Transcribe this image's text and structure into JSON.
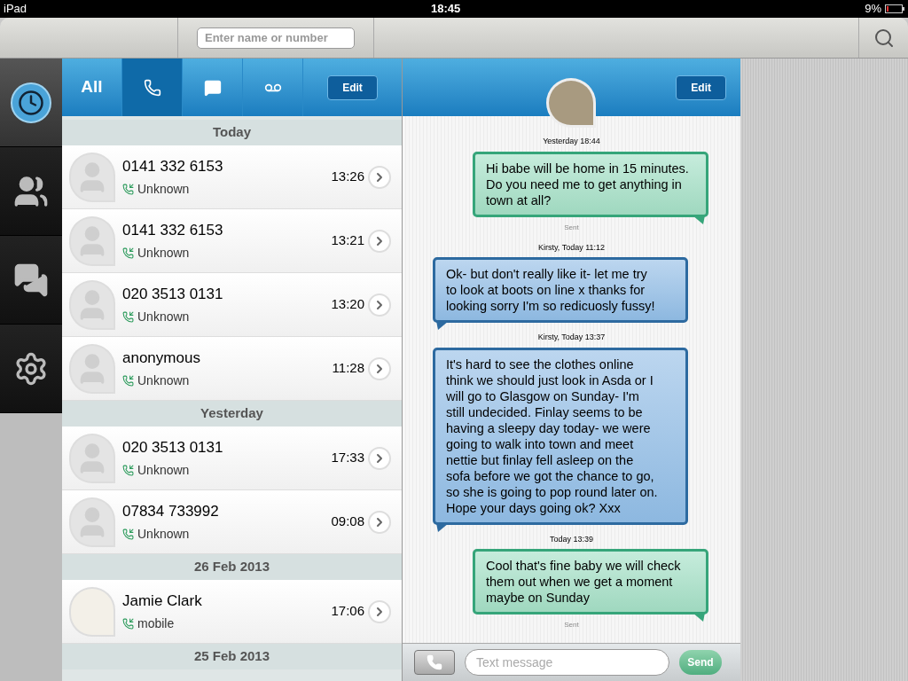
{
  "status_bar": {
    "device": "iPad",
    "time": "18:45",
    "battery": "9%"
  },
  "search": {
    "placeholder": "Enter name or number"
  },
  "rail": [
    {
      "kind": "recents",
      "selected": true
    },
    {
      "kind": "contacts",
      "selected": false
    },
    {
      "kind": "messages",
      "selected": false
    },
    {
      "kind": "settings",
      "selected": false
    }
  ],
  "call_tabs": [
    {
      "kind": "all",
      "label": "All",
      "selected": false
    },
    {
      "kind": "calls",
      "selected": true
    },
    {
      "kind": "messages",
      "selected": false
    },
    {
      "kind": "voicemail",
      "selected": false
    }
  ],
  "calls_edit": "Edit",
  "sections": [
    {
      "title": "Today",
      "rows": [
        {
          "kind": "silhouette",
          "name": "0141 332 6153",
          "type": "Unknown",
          "time": "13:26"
        },
        {
          "kind": "silhouette",
          "name": "0141 332 6153",
          "type": "Unknown",
          "time": "13:21"
        },
        {
          "kind": "silhouette",
          "name": "020 3513 0131",
          "type": "Unknown",
          "time": "13:20"
        },
        {
          "kind": "silhouette",
          "name": "anonymous",
          "type": "Unknown",
          "time": "11:28"
        }
      ]
    },
    {
      "title": "Yesterday",
      "rows": [
        {
          "kind": "silhouette",
          "name": "020 3513 0131",
          "type": "Unknown",
          "time": "17:33"
        },
        {
          "kind": "silhouette",
          "name": "07834 733992",
          "type": "Unknown",
          "time": "09:08"
        }
      ]
    },
    {
      "title": "26 Feb 2013",
      "rows": [
        {
          "kind": "photo",
          "name": "Jamie Clark",
          "type": "mobile",
          "time": "17:06"
        }
      ]
    },
    {
      "title": "25 Feb 2013"
    }
  ],
  "chat": {
    "edit": "Edit",
    "messages": [
      {
        "kind": "sent",
        "meta": "Yesterday 18:44",
        "text": "Hi babe will be home in 15 minutes. Do you need me to get anything in town at all?",
        "status": "Sent"
      },
      {
        "kind": "received",
        "meta": "Kirsty, Today 11:12",
        "text": "Ok- but don't really like it- let me try to look at boots on line x thanks for looking sorry I'm so redicuosly fussy!"
      },
      {
        "kind": "received",
        "meta": "Kirsty, Today 13:37",
        "text": "It's hard to see the clothes online think we should just look in Asda or I will go to Glasgow on Sunday- I'm still undecided. Finlay seems to be having a sleepy day today- we were going to walk into town and meet nettie but finlay fell asleep on the sofa before we got the chance to go, so she is going to pop round later on. Hope your days going ok? Xxx"
      },
      {
        "kind": "sent",
        "meta": "Today 13:39",
        "text": "Cool that's fine baby we will check them out when we get a moment maybe on Sunday",
        "status": "Sent"
      }
    ],
    "composer": {
      "placeholder": "Text message",
      "send": "Send"
    }
  }
}
